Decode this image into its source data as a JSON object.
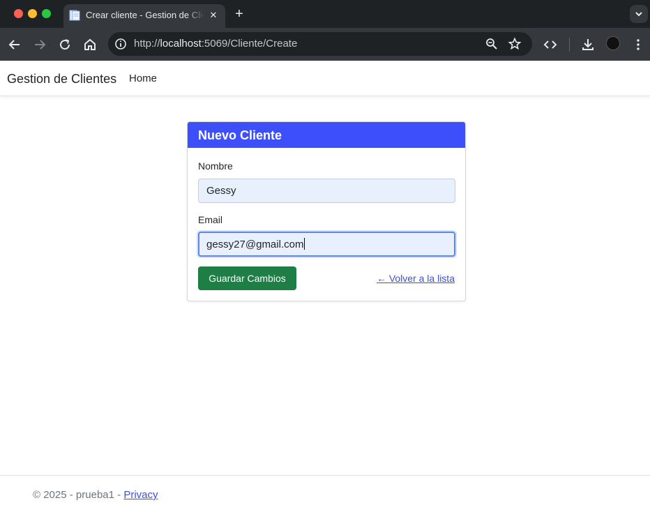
{
  "browser": {
    "tab_title": "Crear cliente - Gestion de Clientes",
    "url_prefix": "http://",
    "url_host": "localhost",
    "url_path": ":5069/Cliente/Create",
    "new_tab_symbol": "+",
    "close_symbol": "✕"
  },
  "navbar": {
    "brand": "Gestion de Clientes",
    "home": "Home"
  },
  "card": {
    "title": "Nuevo Cliente",
    "nombre_label": "Nombre",
    "nombre_value": "Gessy",
    "email_label": "Email",
    "email_value": "gessy27@gmail.com",
    "save_button": "Guardar Cambios",
    "back_link": "← Volver a la lista"
  },
  "footer": {
    "text": "© 2025 - prueba1 - ",
    "privacy": "Privacy"
  },
  "colors": {
    "card_header": "#3d4ffa",
    "save_button": "#1e7e45",
    "link": "#3a4ee8",
    "input_bg": "#e8f0fe"
  },
  "icons": [
    "back-arrow-icon",
    "forward-arrow-icon",
    "reload-icon",
    "home-icon",
    "site-info-icon",
    "zoom-icon",
    "bookmark-star-icon",
    "code-icon",
    "download-icon",
    "more-menu-icon",
    "chevron-down-icon"
  ]
}
